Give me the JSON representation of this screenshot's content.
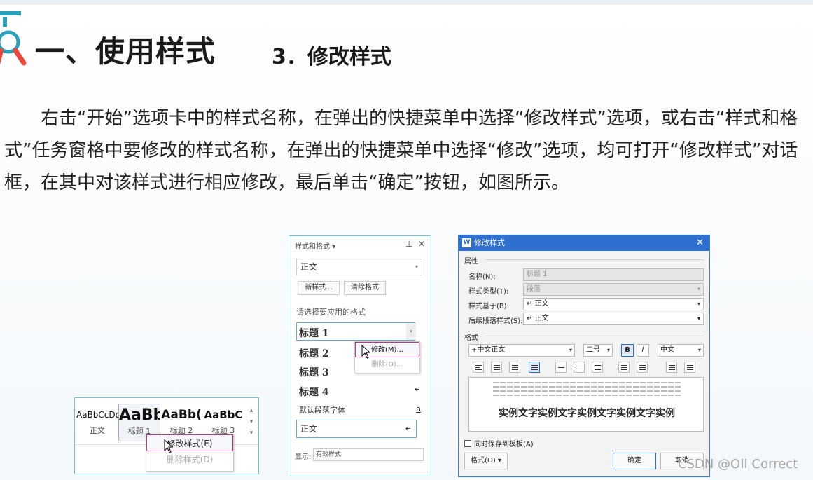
{
  "header": {
    "title": "一、使用样式",
    "subtitle": "3．修改样式"
  },
  "paragraph": "右击“开始”选项卡中的样式名称，在弹出的快捷菜单中选择“修改样式”选项，或右击“样式和格式”任务窗格中要修改的样式名称，在弹出的快捷菜单中选择“修改”选项，均可打开“修改样式”对话框，在其中对该样式进行相应修改，最后单击“确定”按钮，如图所示。",
  "ribbon": {
    "styles": [
      {
        "sample": "AaBbCcDd",
        "label": "正文"
      },
      {
        "sample": "AaBb",
        "label": "标题 1"
      },
      {
        "sample": "AaBb(",
        "label": "标题 2"
      },
      {
        "sample": "AaBbC",
        "label": "标题 3"
      }
    ],
    "menu": {
      "modify": "修改样式(E)",
      "delete": "删除样式(D)"
    }
  },
  "pane": {
    "title": "样式和格式 ▾",
    "current": "正文",
    "new_btn": "新样式...",
    "clear_btn": "清除格式",
    "section": "请选择要应用的格式",
    "items": [
      "标题  1",
      "标题  2",
      "标题  3",
      "标题  4"
    ],
    "default_font": "默认段落字体",
    "default_font_mark": "a",
    "body_item": "正文",
    "menu": {
      "modify": "修改(M)...",
      "delete": "删除(D)..."
    },
    "show_label": "显示:",
    "show_value": "有效样式"
  },
  "dialog": {
    "title": "修改样式",
    "props_group": "属性",
    "name_label": "名称(N):",
    "name_value": "标题 1",
    "type_label": "样式类型(T):",
    "type_value": "段落",
    "based_label": "样式基于(B):",
    "based_value": "↵ 正文",
    "next_label": "后续段落样式(S):",
    "next_value": "↵ 正文",
    "format_group": "格式",
    "font": "+中文正文",
    "size": "二号",
    "bold": "B",
    "italic": "I",
    "lang": "中文",
    "sample": "实例文字实例文字实例文字实例文字实例",
    "save_template": "同时保存到模板(A)",
    "format_btn": "格式(O)",
    "ok": "确定",
    "cancel": "取消"
  },
  "watermark": "CSDN @OII Correct"
}
